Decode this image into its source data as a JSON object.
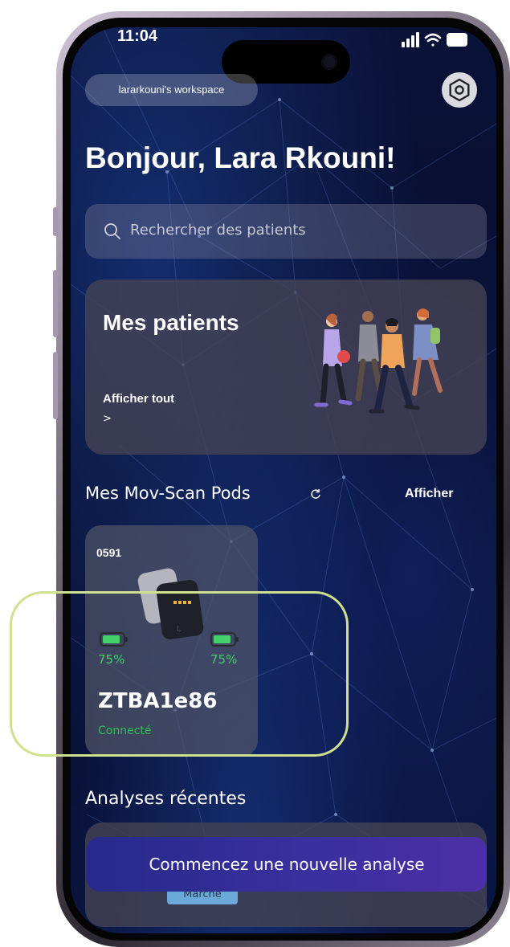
{
  "status_bar": {
    "time": "11:04"
  },
  "header": {
    "workspace": "lararkouni's workspace",
    "greeting": "Bonjour, Lara Rkouni!"
  },
  "search": {
    "placeholder": "Rechercher des patients"
  },
  "patients_card": {
    "title": "Mes patients",
    "link": "Afficher tout",
    "chevron": ">"
  },
  "pods_section": {
    "title": "Mes Mov-Scan Pods",
    "more": "Afficher",
    "pods": [
      {
        "code": "0591",
        "battery_left": "75%",
        "battery_right": "75%",
        "battery_level": 0.75,
        "name": "ZTBA1e86",
        "status": "Connecté"
      }
    ]
  },
  "recent_section": {
    "title": "Analyses récentes",
    "tag": "Marche"
  },
  "cta": {
    "label": "Commencez une nouvelle analyse"
  },
  "colors": {
    "background": "#070d2b",
    "battery_green": "#46d06a",
    "status_green": "#2fbf53",
    "cta_start": "#262a8a",
    "cta_end": "#4b2fa6",
    "highlight": "#cfe08e"
  },
  "icons": [
    "signal-icon",
    "wifi-icon",
    "battery-icon",
    "settings-icon",
    "search-icon",
    "refresh-icon",
    "battery-icon"
  ]
}
